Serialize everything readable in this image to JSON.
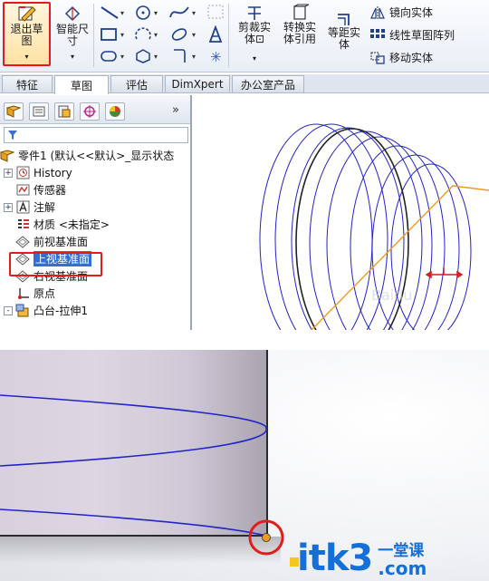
{
  "ribbon": {
    "exit_sketch": "退出草\n图",
    "smart_dim": "智能尺\n寸",
    "trim": "剪裁实\n体⊡",
    "convert": "转换实\n体引用",
    "offset": "等距实\n体",
    "mirror": "镜向实体",
    "linear_pattern": "线性草图阵列",
    "move": "移动实体"
  },
  "tabs": [
    "特征",
    "草图",
    "评估",
    "DimXpert",
    "办公室产品"
  ],
  "active_tab": "草图",
  "feature_manager": {
    "expand_label": "»",
    "tree": [
      {
        "label": "零件1 (默认<<默认>_显示状态",
        "expander": "",
        "icon": "part-icon"
      },
      {
        "label": "History",
        "expander": "+",
        "icon": "history-icon"
      },
      {
        "label": "传感器",
        "expander": "",
        "icon": "sensor-icon"
      },
      {
        "label": "注解",
        "expander": "+",
        "icon": "annotation-icon"
      },
      {
        "label": "材质 <未指定>",
        "expander": "",
        "icon": "material-icon"
      },
      {
        "label": "前视基准面",
        "expander": "",
        "icon": "plane-icon"
      },
      {
        "label": "上视基准面",
        "expander": "",
        "icon": "plane-icon"
      },
      {
        "label": "右视基准面",
        "expander": "",
        "icon": "plane-icon"
      },
      {
        "label": "原点",
        "expander": "",
        "icon": "origin-icon"
      },
      {
        "label": "凸台-拉伸1",
        "expander": "-",
        "icon": "boss-extrude-icon"
      }
    ]
  },
  "canvas": {
    "watermark": "Baidu"
  },
  "watermark": {
    "main": "itk3",
    "cn": "一堂课",
    "com": ".com"
  },
  "colors": {
    "highlight_red": "#e31b1b",
    "sketch_blue": "#2222cc",
    "selection_orange": "#f39a1e",
    "brand_blue": "#1470d8"
  }
}
